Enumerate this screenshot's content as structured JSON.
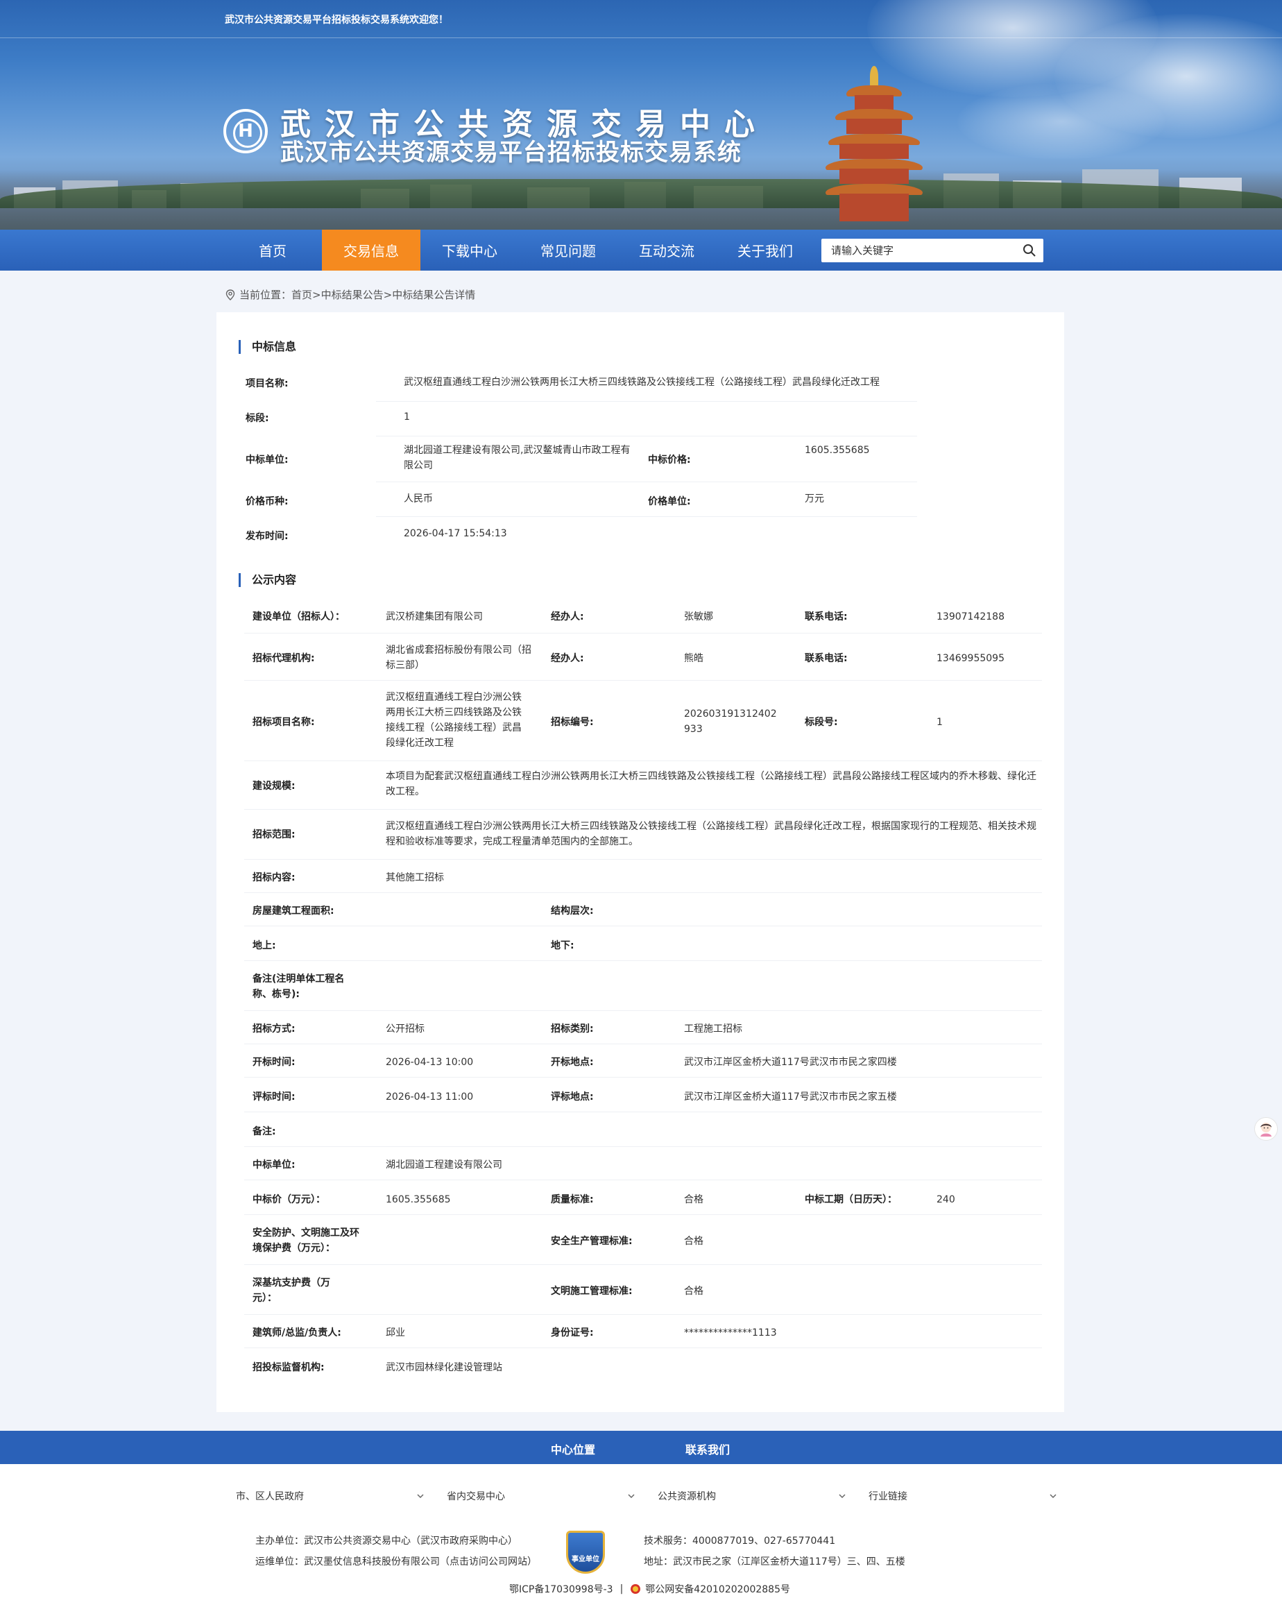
{
  "header": {
    "welcome": "武汉市公共资源交易平台招标投标交易系统欢迎您！",
    "title_main": "武汉市公共资源交易中心",
    "title_sub": "武汉市公共资源交易平台招标投标交易系统"
  },
  "nav": {
    "items": [
      {
        "label": "首页"
      },
      {
        "label": "交易信息",
        "active": true
      },
      {
        "label": "下载中心"
      },
      {
        "label": "常见问题"
      },
      {
        "label": "互动交流"
      },
      {
        "label": "关于我们"
      }
    ],
    "search_placeholder": "请输入关键字"
  },
  "breadcrumb": {
    "prefix": "当前位置：",
    "home": "首页",
    "sep1": ">",
    "list": "中标结果公告",
    "sep2": ">",
    "current": "中标结果公告详情"
  },
  "winning_info": {
    "section_title": "中标信息",
    "project_name_label": "项目名称:",
    "project_name": "武汉枢纽直通线工程白沙洲公铁两用长江大桥三四线铁路及公铁接线工程（公路接线工程）武昌段绿化迁改工程",
    "section_label": "标段:",
    "section_value": "1",
    "winner_label": "中标单位:",
    "winner_value": "湖北园道工程建设有限公司,武汉鳌城青山市政工程有限公司",
    "price_label": "中标价格:",
    "price_value": "1605.355685",
    "currency_label": "价格币种:",
    "currency_value": "人民币",
    "unit_label": "价格单位:",
    "unit_value": "万元",
    "publish_label": "发布时间:",
    "publish_value": "2026-04-17 15:54:13"
  },
  "notice": {
    "section_title": "公示内容",
    "builder_label": "建设单位（招标人）：",
    "builder_value": "武汉桥建集团有限公司",
    "handler1_label": "经办人:",
    "handler1_value": "张敏娜",
    "phone1_label": "联系电话:",
    "phone1_value": "13907142188",
    "agency_label": "招标代理机构:",
    "agency_value": "湖北省成套招标股份有限公司（招标三部）",
    "handler2_label": "经办人:",
    "handler2_value": "熊皓",
    "phone2_label": "联系电话:",
    "phone2_value": "13469955095",
    "project_label": "招标项目名称:",
    "project_value": "武汉枢纽直通线工程白沙洲公铁两用长江大桥三四线铁路及公铁接线工程（公路接线工程）武昌段绿化迁改工程",
    "code_label": "招标编号:",
    "code_value": "202603191312402933",
    "lot_label": "标段号:",
    "lot_value": "1",
    "scale_label": "建设规模:",
    "scale_value": "本项目为配套武汉枢纽直通线工程白沙洲公铁两用长江大桥三四线铁路及公铁接线工程（公路接线工程）武昌段公路接线工程区域内的乔木移栽、绿化迁改工程。",
    "scope_label": "招标范围:",
    "scope_value": "武汉枢纽直通线工程白沙洲公铁两用长江大桥三四线铁路及公铁接线工程（公路接线工程）武昌段绿化迁改工程，根据国家现行的工程规范、相关技术规程和验收标准等要求，完成工程量清单范围内的全部施工。",
    "content_label": "招标内容:",
    "content_value": "其他施工招标",
    "area_label": "房屋建筑工程面积:",
    "area_value": "",
    "levels_label": "结构层次:",
    "levels_value": "",
    "above_label": "地上:",
    "above_value": "",
    "below_label": "地下:",
    "below_value": "",
    "remark1_label": "备注(注明单体工程名称、栋号):",
    "remark1_value": "",
    "method_label": "招标方式:",
    "method_value": "公开招标",
    "type_label": "招标类别:",
    "type_value": "工程施工招标",
    "open_time_label": "开标时间:",
    "open_time_value": "2026-04-13 10:00",
    "open_place_label": "开标地点:",
    "open_place_value": "武汉市江岸区金桥大道117号武汉市市民之家四楼",
    "eval_time_label": "评标时间:",
    "eval_time_value": "2026-04-13 11:00",
    "eval_place_label": "评标地点:",
    "eval_place_value": "武汉市江岸区金桥大道117号武汉市市民之家五楼",
    "remark2_label": "备注:",
    "remark2_value": "",
    "winner_label": "中标单位:",
    "winner_value": "湖北园道工程建设有限公司",
    "bid_price_label": "中标价（万元）：",
    "bid_price_value": "1605.355685",
    "quality_label": "质量标准:",
    "quality_value": "合格",
    "period_label": "中标工期（日历天）：",
    "period_value": "240",
    "safety_fee_label": "安全防护、文明施工及环境保护费（万元）：",
    "safety_fee_value": "",
    "safety_std_label": "安全生产管理标准:",
    "safety_std_value": "合格",
    "pit_fee_label": "深基坑支护费（万元）：",
    "pit_fee_value": "",
    "civil_std_label": "文明施工管理标准:",
    "civil_std_value": "合格",
    "manager_label": "建筑师/总监/负责人:",
    "manager_value": "邱业",
    "id_label": "身份证号:",
    "id_value": "**************1113",
    "supervisor_label": "招投标监督机构:",
    "supervisor_value": "武汉市园林绿化建设管理站"
  },
  "footer": {
    "links": [
      "中心位置",
      "联系我们"
    ],
    "dropdowns": [
      "市、区人民政府",
      "省内交易中心",
      "公共资源机构",
      "行业链接"
    ],
    "host": "主办单位：武汉市公共资源交易中心（武汉市政府采购中心）",
    "operator": "运维单位：武汉墨仗信息科技股份有限公司（点击访问公司网站）",
    "badge_text": "事业单位",
    "tech": "技术服务：4000877019、027-65770441",
    "address": "地址：武汉市民之家（江岸区金桥大道117号）三、四、五楼",
    "icp": "鄂ICP备17030998号-3",
    "divider": "|",
    "police": "鄂公网安备42010202002885号"
  },
  "colors": {
    "nav_blue": "#2a61b8",
    "nav_active": "#f58a1f",
    "section_bar": "#2a61b8"
  }
}
